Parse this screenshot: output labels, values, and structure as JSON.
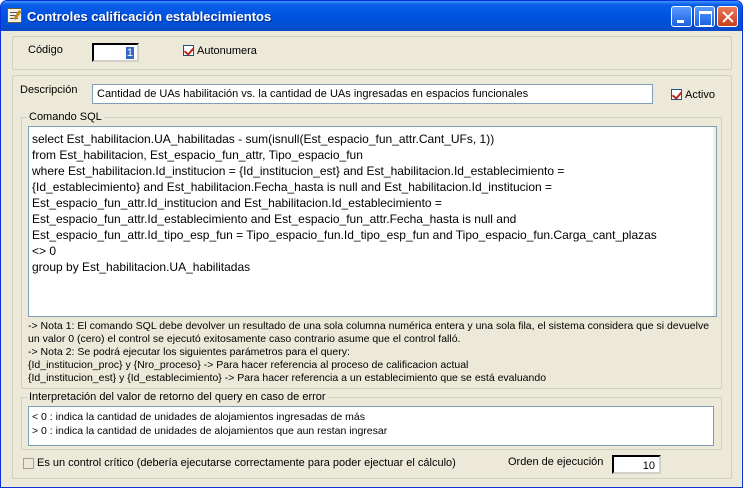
{
  "window": {
    "title": "Controles calificación establecimientos"
  },
  "codigo": {
    "label": "Código",
    "value": "1"
  },
  "autonumera": {
    "label": "Autonumera",
    "checked": true
  },
  "descripcion": {
    "label": "Descripción",
    "value": "Cantidad de UAs habilitación vs. la cantidad de UAs ingresadas en espacios funcionales"
  },
  "activo": {
    "label": "Activo",
    "checked": true
  },
  "comando_sql": {
    "label": "Comando SQL",
    "lines": [
      "select Est_habilitacion.UA_habilitadas - sum(isnull(Est_espacio_fun_attr.Cant_UFs, 1))",
      "from Est_habilitacion, Est_espacio_fun_attr, Tipo_espacio_fun",
      "where Est_habilitacion.Id_institucion = {Id_institucion_est} and Est_habilitacion.Id_establecimiento =",
      "{Id_establecimiento} and Est_habilitacion.Fecha_hasta is null and Est_habilitacion.Id_institucion =",
      "Est_espacio_fun_attr.Id_institucion and Est_habilitacion.Id_establecimiento =",
      "Est_espacio_fun_attr.Id_establecimiento and Est_espacio_fun_attr.Fecha_hasta is null and",
      "Est_espacio_fun_attr.Id_tipo_esp_fun = Tipo_espacio_fun.Id_tipo_esp_fun and Tipo_espacio_fun.Carga_cant_plazas",
      "<> 0",
      "group by Est_habilitacion.UA_habilitadas"
    ],
    "notes": [
      "-> Nota 1: El comando SQL debe devolver un resultado de una sola columna numérica entera y una sola fila, el sistema considera que si devuelve",
      "un valor 0 (cero) el control se ejecutó exitosamente caso contrario asume que el control falló.",
      "-> Nota 2: Se podrá ejecutar los siguientes parámetros para el query:",
      "{Id_institucion_proc} y {Nro_proceso} -> Para hacer referencia al proceso de calificacion actual",
      "{Id_institucion_est} y {Id_establecimiento} -> Para hacer referencia a un establecimiento que se está evaluando"
    ]
  },
  "interpretacion": {
    "label": "Interpretación del valor de retorno del query en caso de error",
    "lines": [
      "< 0 : indica la cantidad de unidades de alojamientos ingresadas de más",
      "> 0 : indica la cantidad de unidades de alojamientos que aun restan ingresar"
    ]
  },
  "control_critico": {
    "label": "Es un control crítico (debería ejecutarse correctamente para poder ejectuar el cálculo)",
    "checked": false
  },
  "orden": {
    "label": "Orden de ejecución",
    "value": "10"
  },
  "icons": {
    "window_icon": "form-edit-icon",
    "minimize": "minimize-icon",
    "maximize": "maximize-icon",
    "close": "close-icon"
  },
  "colors": {
    "titlebar": "#0054e3",
    "window_bg": "#ece9d8",
    "check_mark": "#c0261a"
  }
}
